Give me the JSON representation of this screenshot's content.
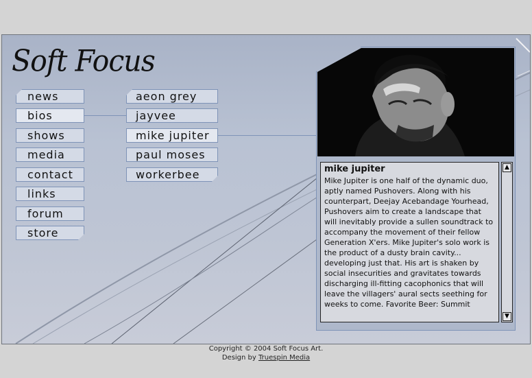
{
  "site": {
    "logo_text": "Soft Focus"
  },
  "main_nav": [
    {
      "label": "news"
    },
    {
      "label": "bios"
    },
    {
      "label": "shows"
    },
    {
      "label": "media"
    },
    {
      "label": "contact"
    },
    {
      "label": "links"
    },
    {
      "label": "forum"
    },
    {
      "label": "store"
    }
  ],
  "bios_nav": [
    {
      "label": "aeon grey"
    },
    {
      "label": "jayvee"
    },
    {
      "label": "mike jupiter"
    },
    {
      "label": "paul moses"
    },
    {
      "label": "workerbee"
    }
  ],
  "bio": {
    "title": "mike jupiter",
    "text": "Mike Jupiter is one half of the dynamic duo, aptly named Pushovers. Along with his counterpart, Deejay Acebandage Yourhead, Pushovers aim to create a landscape that will inevitably provide a sullen soundtrack to accompany the movement of their fellow Generation X'ers. Mike Jupiter's solo work is the product of a dusty brain cavity... developing just that. His art is shaken by social insecurities and gravitates towards discharging ill-fitting cacophonics that will leave the villagers' aural sects seething for weeks to come. Favorite Beer: Summit"
  },
  "scrollbar": {
    "up_icon": "scroll-up-arrow-icon",
    "down_icon": "scroll-down-arrow-icon"
  },
  "footer": {
    "copyright": "Copyright © 2004 Soft Focus Art.",
    "design_prefix": "Design by",
    "design_link": "Truespin Media"
  },
  "colors": {
    "nav_border": "#7e93b7",
    "nav_bg": "#d4dae6",
    "panel_bg": "#d7d9df"
  }
}
